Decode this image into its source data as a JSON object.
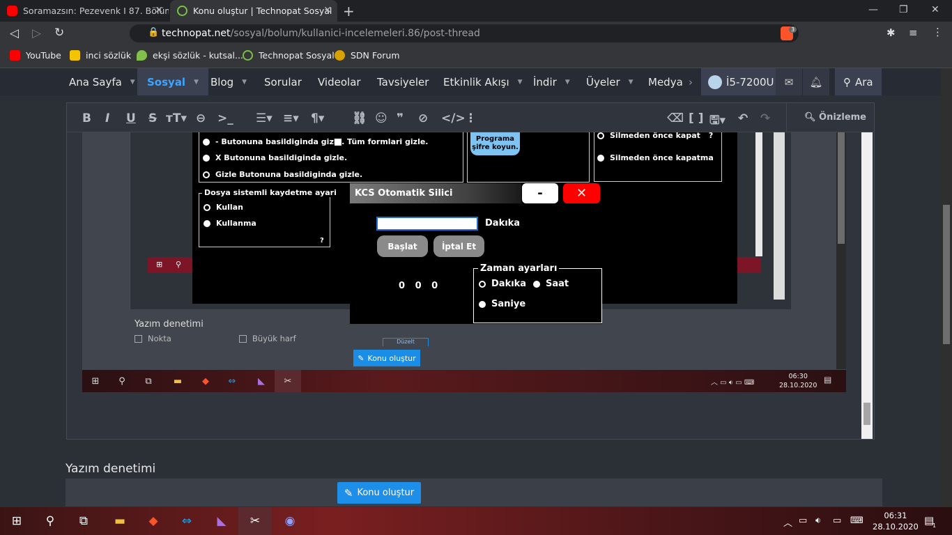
{
  "browser": {
    "tabs": [
      {
        "title": "Soramazsın: Pezevenk I 87. Bölüm",
        "favicon": "youtube-icon"
      },
      {
        "title": "Konu oluştur | Technopat Sosyal",
        "favicon": "technopat-icon"
      }
    ],
    "url_host": "technopat.net",
    "url_path": "/sosyal/bolum/kullanici-incelemeleri.86/post-thread",
    "brave_badge": "3",
    "bookmarks": [
      "YouTube",
      "inci sözlük",
      "ekşi sözlük - kutsal...",
      "Technopat Sosyal",
      "SDN Forum"
    ]
  },
  "site_nav": {
    "items": [
      "Ana Sayfa",
      "Sosyal",
      "Blog",
      "Sorular",
      "Videolar",
      "Tavsiyeler",
      "Etkinlik Akışı",
      "İndir",
      "Üyeler",
      "Medya"
    ],
    "user": "İ5-7200U",
    "search": "Ara"
  },
  "editor": {
    "toolbar_buttons": [
      "B",
      "I",
      "U",
      "S",
      "T",
      "link",
      "code",
      "list",
      "align",
      "paragraph",
      "url",
      "smiley",
      "quote",
      "spoiler",
      "source",
      "more"
    ],
    "preview_label": "Önizleme"
  },
  "app_window": {
    "options_top": [
      "- Butonuna basildiginda gizle.",
      "X Butonuna basildiginda gizle.",
      "Gizle Butonuna basildiginda gizle."
    ],
    "tum_formlari": "Tüm formlari gizle.",
    "sifre_button": "Programa şifre koyun.",
    "right_options": [
      "Silmeden önce kapat",
      "Silmeden önce kapatma"
    ],
    "right_help": "?",
    "dosya_group": {
      "legend": "Dosya sistemli kaydetme ayari",
      "options": [
        "Kullan",
        "Kullanma"
      ],
      "help": "?"
    }
  },
  "kcs_dialog": {
    "title": "KCS Otomatik Silici",
    "min_label": "-",
    "close_label": "✕",
    "input_value": "",
    "input_suffix": "Dakıka",
    "start_label": "Başlat",
    "cancel_label": "İptal Et",
    "counter": [
      "0",
      "0",
      "0"
    ],
    "time_group": {
      "legend": "Zaman ayarları",
      "options": [
        "Dakıka",
        "Saat",
        "Saniye"
      ],
      "selected": "Dakıka"
    }
  },
  "inner_form": {
    "spell_title": "Yazım denetimi",
    "checks": [
      "Nokta",
      "Büyük harf"
    ],
    "duzelt": "Düzelt",
    "submit": "Konu oluştur",
    "clock_time": "06:30",
    "clock_date": "28.10.2020"
  },
  "page_bottom": {
    "spell_title": "Yazım denetimi",
    "submit": "Konu oluştur"
  },
  "taskbar": {
    "time": "06:31",
    "date": "28.10.2020",
    "notifications": "1"
  }
}
